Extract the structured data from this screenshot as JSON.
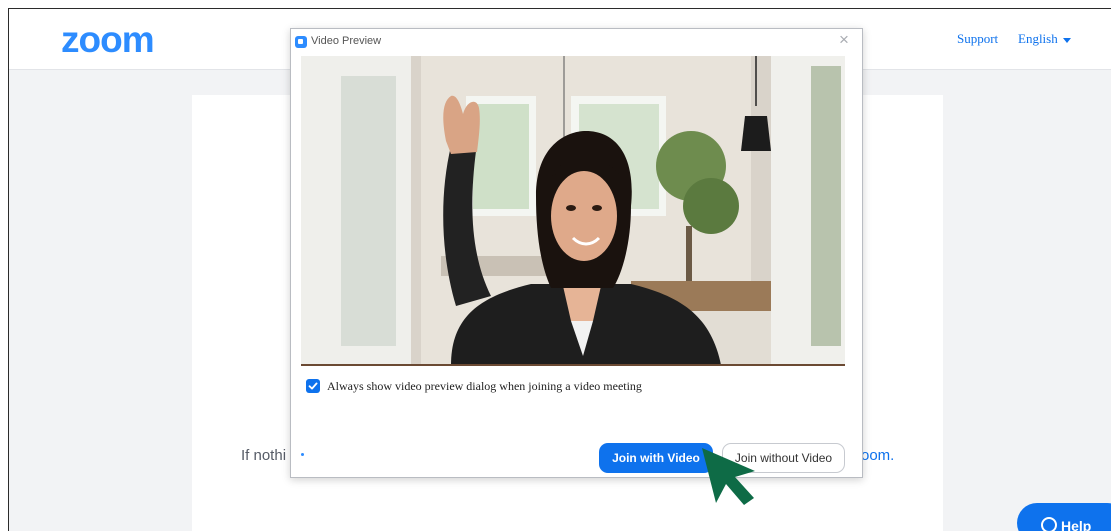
{
  "header": {
    "logo_text": "zoom",
    "support_label": "Support",
    "language_label": "English"
  },
  "background": {
    "text_left": "If nothi",
    "text_right": "oom."
  },
  "dialog": {
    "title": "Video Preview",
    "close_icon": "close-icon",
    "checkbox_label": "Always show video preview dialog when joining a video meeting",
    "checkbox_checked": true,
    "join_with_video_label": "Join with Video",
    "join_without_video_label": "Join without Video"
  },
  "help": {
    "label": "Help"
  },
  "colors": {
    "brand_blue": "#2d8cff",
    "button_blue": "#0e72ed",
    "cursor_green": "#0e6b46"
  }
}
